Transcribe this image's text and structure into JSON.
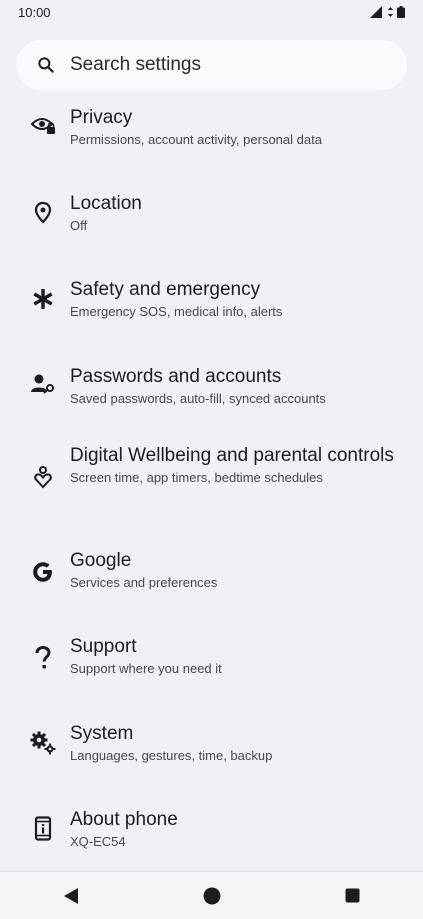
{
  "status_bar": {
    "time": "10:00",
    "icons": [
      "signal-icon",
      "data-arrows-icon",
      "battery-icon"
    ]
  },
  "search": {
    "placeholder": "Search settings",
    "icon": "search-icon"
  },
  "settings": [
    {
      "key": "privacy",
      "icon": "privacy-eye-lock-icon",
      "title": "Privacy",
      "subtitle": "Permissions, account activity, personal data"
    },
    {
      "key": "location",
      "icon": "location-pin-icon",
      "title": "Location",
      "subtitle": "Off"
    },
    {
      "key": "safety",
      "icon": "asterisk-icon",
      "title": "Safety and emergency",
      "subtitle": "Emergency SOS, medical info, alerts"
    },
    {
      "key": "passwords",
      "icon": "account-key-icon",
      "title": "Passwords and accounts",
      "subtitle": "Saved passwords, auto-fill, synced accounts"
    },
    {
      "key": "wellbeing",
      "icon": "wellbeing-heart-icon",
      "title": "Digital Wellbeing and parental controls",
      "subtitle": "Screen time, app timers, bedtime schedules"
    },
    {
      "key": "google",
      "icon": "google-g-icon",
      "title": "Google",
      "subtitle": "Services and preferences"
    },
    {
      "key": "support",
      "icon": "question-mark-icon",
      "title": "Support",
      "subtitle": "Support where you need it"
    },
    {
      "key": "system",
      "icon": "gears-icon",
      "title": "System",
      "subtitle": "Languages, gestures, time, backup"
    },
    {
      "key": "about",
      "icon": "phone-info-icon",
      "title": "About phone",
      "subtitle": "XQ-EC54"
    }
  ],
  "nav": {
    "back": "back-triangle-icon",
    "home": "home-circle-icon",
    "recents": "recents-square-icon"
  }
}
